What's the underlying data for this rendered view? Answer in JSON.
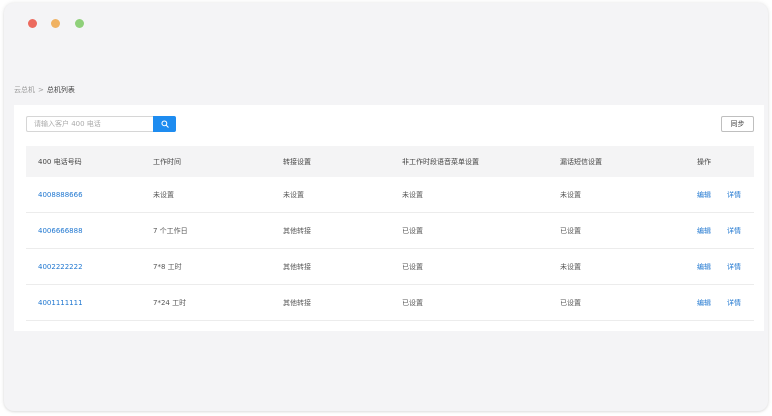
{
  "breadcrumb": {
    "items": [
      "云总机",
      "总机列表"
    ],
    "separator": ">"
  },
  "search": {
    "placeholder": "请输入客户 400 电话"
  },
  "toolbar": {
    "sync_label": "同步"
  },
  "table": {
    "headers": [
      "400 电话号码",
      "工作时间",
      "转接设置",
      "非工作时段语音菜单设置",
      "漏话短信设置",
      "操作"
    ],
    "rows": [
      {
        "phone": "4008888666",
        "work_time": "未设置",
        "transfer": "未设置",
        "off_hours_menu": "未设置",
        "missed_sms": "未设置",
        "edit": "编辑",
        "detail": "详情"
      },
      {
        "phone": "4006666888",
        "work_time": "7 个工作日",
        "transfer": "其他转接",
        "off_hours_menu": "已设置",
        "missed_sms": "已设置",
        "edit": "编辑",
        "detail": "详情"
      },
      {
        "phone": "4002222222",
        "work_time": "7*8 工时",
        "transfer": "其他转接",
        "off_hours_menu": "已设置",
        "missed_sms": "未设置",
        "edit": "编辑",
        "detail": "详情"
      },
      {
        "phone": "4001111111",
        "work_time": "7*24 工时",
        "transfer": "其他转接",
        "off_hours_menu": "已设置",
        "missed_sms": "已设置",
        "edit": "编辑",
        "detail": "详情"
      }
    ]
  },
  "colors": {
    "accent": "#1e8cf0",
    "link": "#1e76d0",
    "close": "#ec6a5e",
    "minimize": "#f0b262",
    "maximize": "#8fd07a"
  },
  "icons": {
    "search": "search-icon"
  }
}
